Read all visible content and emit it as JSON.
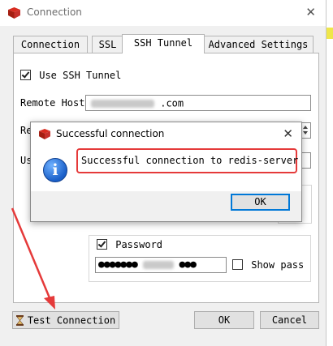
{
  "window": {
    "title": "Connection",
    "close_glyph": "✕"
  },
  "tabs": [
    {
      "label": "Connection"
    },
    {
      "label": "SSL"
    },
    {
      "label": "SSH Tunnel",
      "active": true
    },
    {
      "label": "Advanced Settings"
    }
  ],
  "ssh": {
    "use_label": "Use SSH Tunnel",
    "use_checked": true,
    "remote_host_label": "Remote Host",
    "remote_host_visible_suffix": ".com",
    "remote_port_label_partial": "Re",
    "user_label_partial": "Us",
    "password_label": "Password",
    "password_checked": true,
    "password_masked": "●●●●●●●",
    "password_masked_tail": "●●●",
    "show_pass_label": "Show pass"
  },
  "footer": {
    "test_label": "Test Connection",
    "ok_label": "OK",
    "cancel_label": "Cancel"
  },
  "modal": {
    "title": "Successful connection",
    "close_glyph": "✕",
    "message": "Successful connection to redis-server",
    "ok_label": "OK"
  },
  "colors": {
    "highlight": "#e53a3a",
    "arrow": "#e53a3a",
    "default_button_border": "#0078d7"
  },
  "icons": [
    "redis-app-icon",
    "info-icon",
    "hourglass-icon",
    "close-icon",
    "spin-arrows-icon"
  ]
}
